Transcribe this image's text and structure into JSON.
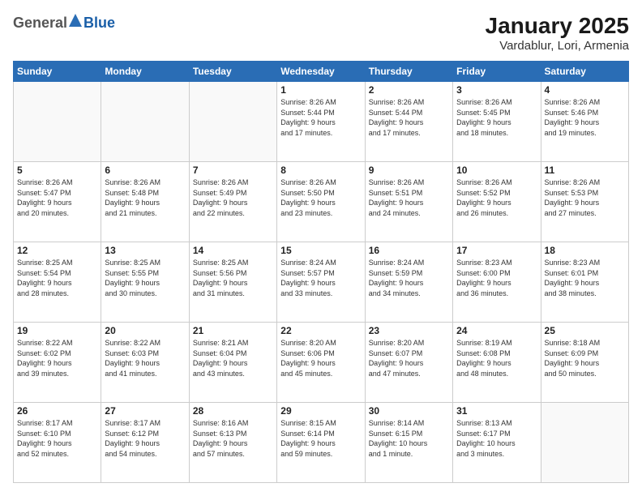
{
  "logo": {
    "general": "General",
    "blue": "Blue"
  },
  "title": "January 2025",
  "subtitle": "Vardablur, Lori, Armenia",
  "weekdays": [
    "Sunday",
    "Monday",
    "Tuesday",
    "Wednesday",
    "Thursday",
    "Friday",
    "Saturday"
  ],
  "weeks": [
    [
      {
        "day": "",
        "sunrise": "",
        "sunset": "",
        "daylight": ""
      },
      {
        "day": "",
        "sunrise": "",
        "sunset": "",
        "daylight": ""
      },
      {
        "day": "",
        "sunrise": "",
        "sunset": "",
        "daylight": ""
      },
      {
        "day": "1",
        "sunrise": "8:26 AM",
        "sunset": "5:44 PM",
        "daylight": "9 hours and 17 minutes."
      },
      {
        "day": "2",
        "sunrise": "8:26 AM",
        "sunset": "5:44 PM",
        "daylight": "9 hours and 17 minutes."
      },
      {
        "day": "3",
        "sunrise": "8:26 AM",
        "sunset": "5:45 PM",
        "daylight": "9 hours and 18 minutes."
      },
      {
        "day": "4",
        "sunrise": "8:26 AM",
        "sunset": "5:46 PM",
        "daylight": "9 hours and 19 minutes."
      }
    ],
    [
      {
        "day": "5",
        "sunrise": "8:26 AM",
        "sunset": "5:47 PM",
        "daylight": "9 hours and 20 minutes."
      },
      {
        "day": "6",
        "sunrise": "8:26 AM",
        "sunset": "5:48 PM",
        "daylight": "9 hours and 21 minutes."
      },
      {
        "day": "7",
        "sunrise": "8:26 AM",
        "sunset": "5:49 PM",
        "daylight": "9 hours and 22 minutes."
      },
      {
        "day": "8",
        "sunrise": "8:26 AM",
        "sunset": "5:50 PM",
        "daylight": "9 hours and 23 minutes."
      },
      {
        "day": "9",
        "sunrise": "8:26 AM",
        "sunset": "5:51 PM",
        "daylight": "9 hours and 24 minutes."
      },
      {
        "day": "10",
        "sunrise": "8:26 AM",
        "sunset": "5:52 PM",
        "daylight": "9 hours and 26 minutes."
      },
      {
        "day": "11",
        "sunrise": "8:26 AM",
        "sunset": "5:53 PM",
        "daylight": "9 hours and 27 minutes."
      }
    ],
    [
      {
        "day": "12",
        "sunrise": "8:25 AM",
        "sunset": "5:54 PM",
        "daylight": "9 hours and 28 minutes."
      },
      {
        "day": "13",
        "sunrise": "8:25 AM",
        "sunset": "5:55 PM",
        "daylight": "9 hours and 30 minutes."
      },
      {
        "day": "14",
        "sunrise": "8:25 AM",
        "sunset": "5:56 PM",
        "daylight": "9 hours and 31 minutes."
      },
      {
        "day": "15",
        "sunrise": "8:24 AM",
        "sunset": "5:57 PM",
        "daylight": "9 hours and 33 minutes."
      },
      {
        "day": "16",
        "sunrise": "8:24 AM",
        "sunset": "5:59 PM",
        "daylight": "9 hours and 34 minutes."
      },
      {
        "day": "17",
        "sunrise": "8:23 AM",
        "sunset": "6:00 PM",
        "daylight": "9 hours and 36 minutes."
      },
      {
        "day": "18",
        "sunrise": "8:23 AM",
        "sunset": "6:01 PM",
        "daylight": "9 hours and 38 minutes."
      }
    ],
    [
      {
        "day": "19",
        "sunrise": "8:22 AM",
        "sunset": "6:02 PM",
        "daylight": "9 hours and 39 minutes."
      },
      {
        "day": "20",
        "sunrise": "8:22 AM",
        "sunset": "6:03 PM",
        "daylight": "9 hours and 41 minutes."
      },
      {
        "day": "21",
        "sunrise": "8:21 AM",
        "sunset": "6:04 PM",
        "daylight": "9 hours and 43 minutes."
      },
      {
        "day": "22",
        "sunrise": "8:20 AM",
        "sunset": "6:06 PM",
        "daylight": "9 hours and 45 minutes."
      },
      {
        "day": "23",
        "sunrise": "8:20 AM",
        "sunset": "6:07 PM",
        "daylight": "9 hours and 47 minutes."
      },
      {
        "day": "24",
        "sunrise": "8:19 AM",
        "sunset": "6:08 PM",
        "daylight": "9 hours and 48 minutes."
      },
      {
        "day": "25",
        "sunrise": "8:18 AM",
        "sunset": "6:09 PM",
        "daylight": "9 hours and 50 minutes."
      }
    ],
    [
      {
        "day": "26",
        "sunrise": "8:17 AM",
        "sunset": "6:10 PM",
        "daylight": "9 hours and 52 minutes."
      },
      {
        "day": "27",
        "sunrise": "8:17 AM",
        "sunset": "6:12 PM",
        "daylight": "9 hours and 54 minutes."
      },
      {
        "day": "28",
        "sunrise": "8:16 AM",
        "sunset": "6:13 PM",
        "daylight": "9 hours and 57 minutes."
      },
      {
        "day": "29",
        "sunrise": "8:15 AM",
        "sunset": "6:14 PM",
        "daylight": "9 hours and 59 minutes."
      },
      {
        "day": "30",
        "sunrise": "8:14 AM",
        "sunset": "6:15 PM",
        "daylight": "10 hours and 1 minute."
      },
      {
        "day": "31",
        "sunrise": "8:13 AM",
        "sunset": "6:17 PM",
        "daylight": "10 hours and 3 minutes."
      },
      {
        "day": "",
        "sunrise": "",
        "sunset": "",
        "daylight": ""
      }
    ]
  ]
}
